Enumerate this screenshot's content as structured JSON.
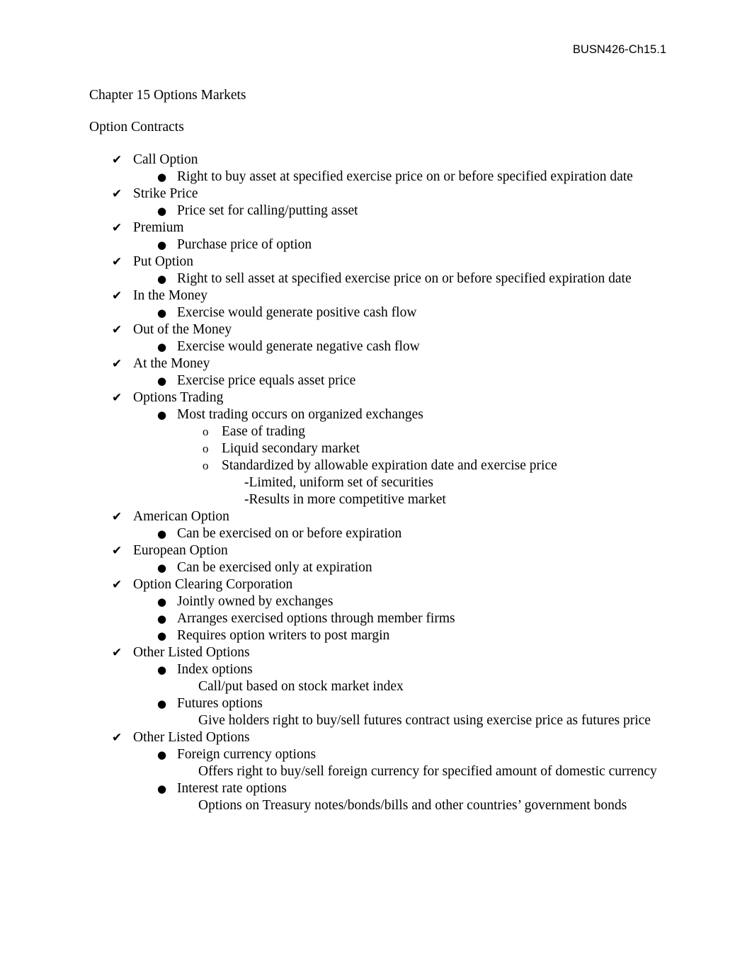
{
  "header": {
    "course_code": "BUSN426-Ch15.1"
  },
  "markers": {
    "check": "✔",
    "disc": "●",
    "circle": "o"
  },
  "document": {
    "chapter_title": "Chapter 15 Options Markets",
    "section_title": "Option Contracts",
    "outline": [
      {
        "level": 1,
        "marker": "check",
        "text": "Call Option"
      },
      {
        "level": 2,
        "marker": "disc",
        "text": "Right to buy asset at specified exercise price on or before specified expiration date"
      },
      {
        "level": 1,
        "marker": "check",
        "text": "Strike Price"
      },
      {
        "level": 2,
        "marker": "disc",
        "text": "Price set for calling/putting asset"
      },
      {
        "level": 1,
        "marker": "check",
        "text": "Premium"
      },
      {
        "level": 2,
        "marker": "disc",
        "text": "Purchase price of option"
      },
      {
        "level": 1,
        "marker": "check",
        "text": "Put Option"
      },
      {
        "level": 2,
        "marker": "disc",
        "text": "Right to sell asset at specified exercise price on or before specified expiration date"
      },
      {
        "level": 1,
        "marker": "check",
        "text": "In the Money"
      },
      {
        "level": 2,
        "marker": "disc",
        "text": "Exercise would generate positive cash flow"
      },
      {
        "level": 1,
        "marker": "check",
        "text": "Out of the Money"
      },
      {
        "level": 2,
        "marker": "disc",
        "text": "Exercise would generate negative cash flow"
      },
      {
        "level": 1,
        "marker": "check",
        "text": "At the Money"
      },
      {
        "level": 2,
        "marker": "disc",
        "text": "Exercise price equals asset price"
      },
      {
        "level": 1,
        "marker": "check",
        "text": "Options Trading"
      },
      {
        "level": 2,
        "marker": "disc",
        "text": "Most trading occurs on organized exchanges"
      },
      {
        "level": 3,
        "marker": "circle",
        "text": "Ease of trading"
      },
      {
        "level": 3,
        "marker": "circle",
        "text": "Liquid secondary market"
      },
      {
        "level": 3,
        "marker": "circle",
        "text": "Standardized by allowable expiration date and exercise price"
      },
      {
        "level": 4,
        "marker": "none",
        "text": "-Limited, uniform set of securities"
      },
      {
        "level": 4,
        "marker": "none",
        "text": "-Results in more competitive market"
      },
      {
        "level": 1,
        "marker": "check",
        "text": "American Option"
      },
      {
        "level": 2,
        "marker": "disc",
        "text": "Can be exercised on or before expiration"
      },
      {
        "level": 1,
        "marker": "check",
        "text": "European Option"
      },
      {
        "level": 2,
        "marker": "disc",
        "text": "Can be exercised only at expiration"
      },
      {
        "level": 1,
        "marker": "check",
        "text": "Option Clearing Corporation"
      },
      {
        "level": 2,
        "marker": "disc",
        "text": "Jointly owned by exchanges"
      },
      {
        "level": 2,
        "marker": "disc",
        "text": "Arranges exercised options through member firms"
      },
      {
        "level": 2,
        "marker": "disc",
        "text": "Requires option writers to post margin"
      },
      {
        "level": 1,
        "marker": "check",
        "text": "Other Listed Options"
      },
      {
        "level": 2,
        "marker": "disc",
        "text": "Index options"
      },
      {
        "level": 3,
        "marker": "none",
        "text": "Call/put based on stock market index"
      },
      {
        "level": 2,
        "marker": "disc",
        "text": "Futures options"
      },
      {
        "level": 3,
        "marker": "none",
        "text": "Give holders right to buy/sell futures contract using exercise price as futures price"
      },
      {
        "level": 1,
        "marker": "check",
        "text": "Other Listed Options"
      },
      {
        "level": 2,
        "marker": "disc",
        "text": "Foreign currency options"
      },
      {
        "level": 3,
        "marker": "none",
        "text": "Offers right to buy/sell foreign currency for specified amount of domestic currency"
      },
      {
        "level": 2,
        "marker": "disc",
        "text": "Interest rate options"
      },
      {
        "level": 3,
        "marker": "none",
        "text": "Options on Treasury notes/bonds/bills and other countries’ government bonds"
      }
    ]
  }
}
